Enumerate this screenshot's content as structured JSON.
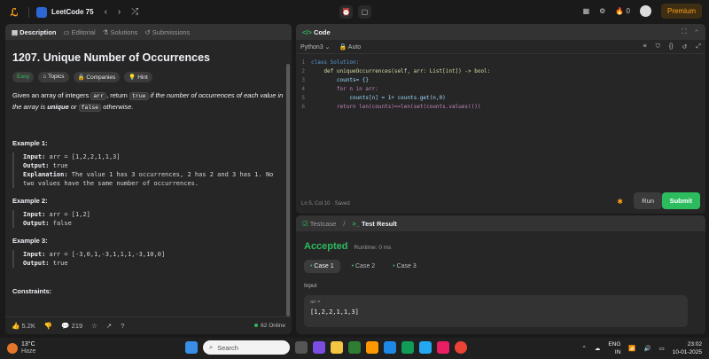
{
  "app": {
    "title": "LeetCode 75"
  },
  "top_right": {
    "notification_count": "0",
    "premium_label": "Premium"
  },
  "left_tabs": [
    "Description",
    "Editorial",
    "Solutions",
    "Submissions"
  ],
  "problem": {
    "title": "1207. Unique Number of Occurrences",
    "tags": [
      "Easy",
      "Topics",
      "Companies",
      "Hint"
    ],
    "desc_1": "Given an array of integers ",
    "desc_arr": "arr",
    "desc_2": ", return ",
    "desc_true": "true",
    "desc_3": " if the number of occurrences of each value in the array is ",
    "desc_unique": "unique",
    "desc_4": " or ",
    "desc_false": "false",
    "desc_5": " otherwise.",
    "examples": [
      {
        "title": "Example 1:",
        "input": "arr = [1,2,2,1,1,3]",
        "output": "true",
        "explanation": "The value 1 has 3 occurrences, 2 has 2 and 3 has 1. No two values have the same number of occurrences."
      },
      {
        "title": "Example 2:",
        "input": "arr = [1,2]",
        "output": "false"
      },
      {
        "title": "Example 3:",
        "input": "arr = [-3,0,1,-3,1,1,1,-3,10,0]",
        "output": "true"
      }
    ],
    "labels": {
      "input": "Input:",
      "output": "Output:",
      "explanation": "Explanation:"
    },
    "constraints": "Constraints:"
  },
  "footer": {
    "likes": "5.2K",
    "comments": "219",
    "online": "62 Online"
  },
  "code_panel": {
    "title": "Code",
    "language": "Python3",
    "mode": "Auto",
    "status": "Ln 5, Col 10 · Saved",
    "run": "Run",
    "submit": "Submit"
  },
  "code_lines": [
    "class Solution:",
    "    def uniqueOccurrences(self, arr: List[int]) -> bool:",
    "        counts= {}",
    "        for n in arr:",
    "            counts[n] = 1+ counts.get(n,0)",
    "        return len(counts)==len(set(counts.values()))"
  ],
  "test_panel": {
    "tab_testcase": "Testcase",
    "tab_result": "Test Result",
    "verdict": "Accepted",
    "runtime": "Runtime: 0 ms",
    "cases": [
      "Case 1",
      "Case 2",
      "Case 3"
    ],
    "input_label": "Input",
    "var": "arr =",
    "value": "[1,2,2,1,1,3]"
  },
  "taskbar": {
    "temp": "13°C",
    "weather": "Haze",
    "search": "Search",
    "lang": "ENG",
    "region": "IN",
    "time": "23:02",
    "date": "10-01-2025"
  }
}
